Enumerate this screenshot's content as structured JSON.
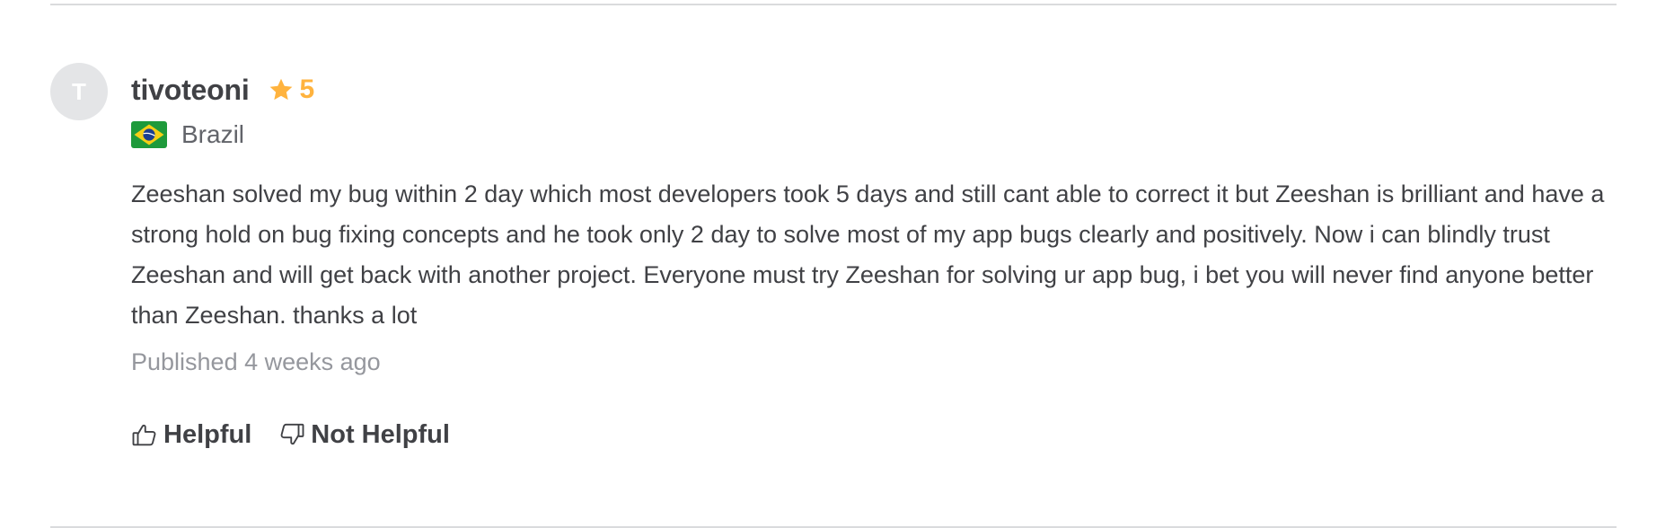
{
  "review": {
    "avatar_initial": "T",
    "username": "tivoteoni",
    "rating": "5",
    "country": "Brazil",
    "text": "Zeeshan solved my bug within 2 day which most developers took 5 days and still cant able to correct it but Zeeshan is brilliant and have a strong hold on bug fixing concepts and he took only 2 day to solve most of my app bugs clearly and positively. Now i can blindly trust Zeeshan and will get back with another project. Everyone must try Zeeshan for solving ur app bug, i bet you will never find anyone better than Zeeshan. thanks a lot",
    "published": "Published 4 weeks ago",
    "helpful_label": "Helpful",
    "not_helpful_label": "Not Helpful"
  },
  "icons": {
    "rating": "star-icon",
    "country": "brazil-flag-icon",
    "helpful": "thumbs-up-icon",
    "not_helpful": "thumbs-down-icon"
  },
  "colors": {
    "star": "#ffb33e",
    "avatar_bg": "#e4e5e7",
    "text": "#404145",
    "muted": "#95979d",
    "divider": "#dadbdd"
  }
}
